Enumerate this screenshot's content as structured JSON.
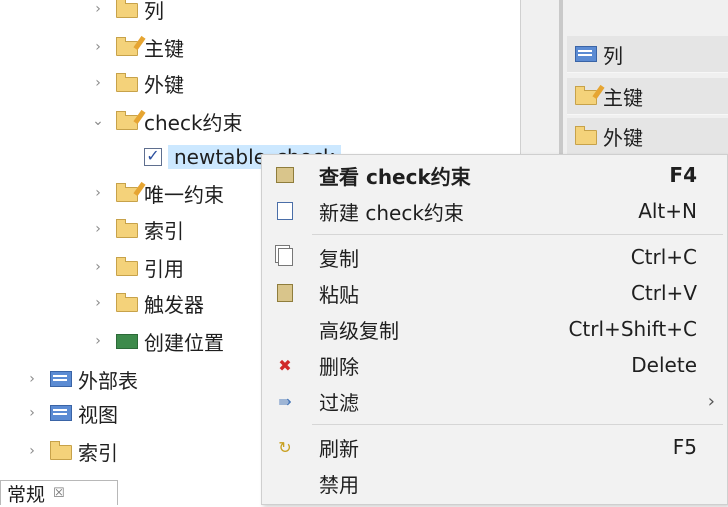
{
  "tree": {
    "items": [
      {
        "label": "列"
      },
      {
        "label": "主键"
      },
      {
        "label": "外键"
      },
      {
        "label": "check约束"
      },
      {
        "label": "newtable_check"
      },
      {
        "label": "唯一约束"
      },
      {
        "label": "索引"
      },
      {
        "label": "引用"
      },
      {
        "label": "触发器"
      },
      {
        "label": "创建位置"
      },
      {
        "label": "外部表"
      },
      {
        "label": "视图"
      },
      {
        "label": "索引"
      }
    ]
  },
  "right_panel": {
    "items": [
      {
        "label": "列"
      },
      {
        "label": "主键"
      },
      {
        "label": "外键"
      }
    ]
  },
  "bottom_tab": {
    "label": "常规",
    "close": "☒"
  },
  "context_menu": {
    "items": [
      {
        "label": "查看 check约束",
        "shortcut": "F4"
      },
      {
        "label": "新建 check约束",
        "shortcut": "Alt+N"
      },
      {
        "label": "复制",
        "shortcut": "Ctrl+C"
      },
      {
        "label": "粘贴",
        "shortcut": "Ctrl+V"
      },
      {
        "label": "高级复制",
        "shortcut": "Ctrl+Shift+C"
      },
      {
        "label": "删除",
        "shortcut": "Delete"
      },
      {
        "label": "过滤",
        "submenu_arrow": "›"
      },
      {
        "label": "刷新",
        "shortcut": "F5"
      },
      {
        "label": "禁用"
      }
    ]
  },
  "icons": {
    "expand": "›",
    "collapse": "⌄",
    "check": "✓",
    "delete": "✖"
  }
}
